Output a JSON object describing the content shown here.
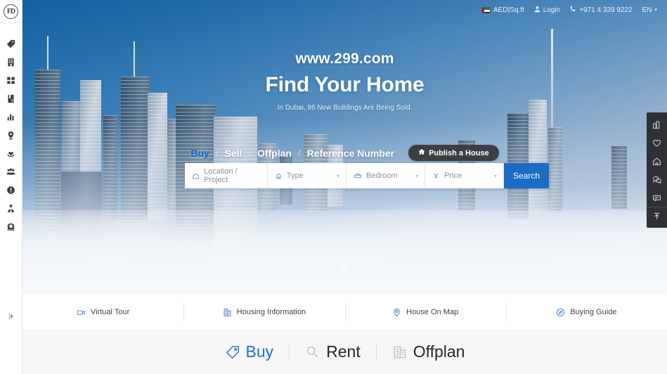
{
  "brand": {
    "logo_text": "FD"
  },
  "topbar": {
    "currency": "AED|Sq.ft",
    "login": "Login",
    "phone": "+971 4 339 9222",
    "language": "EN",
    "language_caret": "▾",
    "flag_icon": "uae-flag-icon",
    "login_icon": "user-icon",
    "phone_icon": "phone-icon"
  },
  "left_rail": {
    "items": [
      {
        "name": "tag",
        "label": "Tag"
      },
      {
        "name": "building",
        "label": "Building"
      },
      {
        "name": "grid",
        "label": "Grid"
      },
      {
        "name": "book",
        "label": "Book"
      },
      {
        "name": "chart",
        "label": "Chart"
      },
      {
        "name": "map-pin",
        "label": "Map Pin"
      },
      {
        "name": "heart-hands",
        "label": "Favorites"
      },
      {
        "name": "group",
        "label": "Community"
      },
      {
        "name": "info",
        "label": "Info"
      },
      {
        "name": "agent",
        "label": "Agent"
      },
      {
        "name": "phone",
        "label": "Contact"
      }
    ],
    "expand_icon": "expand-sidebar-icon"
  },
  "hero": {
    "site_url": "www.299.com",
    "title": "Find Your Home",
    "subtitle": "In Dubai, 86 New Buildings Are Being Sold.",
    "tabs": [
      {
        "label": "Buy",
        "active": true
      },
      {
        "label": "Sell",
        "active": false
      },
      {
        "label": "Offplan",
        "active": false
      },
      {
        "label": "Reference Number",
        "active": false
      }
    ],
    "tab_separator": "/",
    "publish_button": "Publish a House",
    "publish_icon": "home-icon",
    "scroll_icon": "chevron-down-icon"
  },
  "search": {
    "location_placeholder": "Location / Project",
    "type_placeholder": "Type",
    "bedroom_placeholder": "Bedroom",
    "price_placeholder": "Price",
    "button_label": "Search",
    "caret": "▾",
    "accent_color": "#1a6cc4"
  },
  "features": [
    {
      "label": "Virtual Tour",
      "icon": "video-camera-icon"
    },
    {
      "label": "Housing Information",
      "icon": "building-info-icon"
    },
    {
      "label": "House On Map",
      "icon": "map-marker-icon"
    },
    {
      "label": "Buying Guide",
      "icon": "compass-icon"
    }
  ],
  "bottom_tabs": [
    {
      "label": "Buy",
      "icon": "tag-icon",
      "active": true
    },
    {
      "label": "Rent",
      "icon": "magnifier-icon",
      "active": false
    },
    {
      "label": "Offplan",
      "icon": "building-icon",
      "active": false
    }
  ],
  "right_dock": {
    "items": [
      {
        "name": "compare",
        "label": "Compare"
      },
      {
        "name": "heart",
        "label": "Favorites"
      },
      {
        "name": "home",
        "label": "Home"
      },
      {
        "name": "wechat",
        "label": "WeChat"
      },
      {
        "name": "message",
        "label": "Message"
      },
      {
        "name": "back-to-top",
        "label": "Back To Top"
      }
    ]
  },
  "colors": {
    "accent_blue": "#1a6cc4",
    "active_tab_blue": "#1665c0",
    "dock_dark": "#2f3134",
    "publish_dark": "#3a3f44",
    "bottom_bg": "#f7f5f6"
  }
}
